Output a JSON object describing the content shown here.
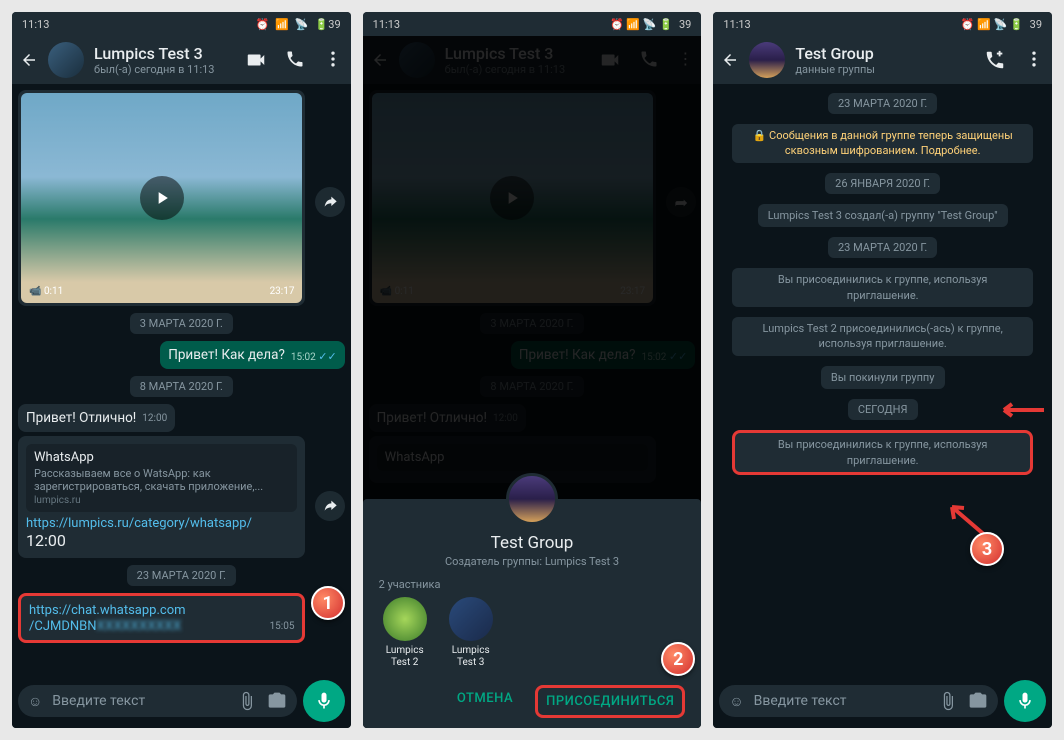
{
  "status": {
    "time": "11:13",
    "battery": "39"
  },
  "panel1": {
    "header": {
      "title": "Lumpics Test 3",
      "subtitle": "был(-а) сегодня в 11:13"
    },
    "video": {
      "duration": "0:11",
      "time": "23:17"
    },
    "dates": {
      "d1": "3 МАРТА 2020 Г.",
      "d2": "8 МАРТА 2020 Г.",
      "d3": "23 МАРТА 2020 Г."
    },
    "msg_out": {
      "text": "Привет! Как дела?",
      "time": "15:02"
    },
    "msg_in1": {
      "text": "Привет! Отлично!",
      "time": "12:00"
    },
    "preview": {
      "title": "WhatsApp",
      "desc": "Рассказываем все о WatsApp: как зарегистрироваться, скачать приложение,...",
      "domain": "lumpics.ru",
      "link": "https://lumpics.ru/category/whatsapp/",
      "time": "12:00"
    },
    "invite": {
      "line1": "https://chat.whatsapp.com",
      "line2": "/CJMDNBN",
      "time": "15:05"
    },
    "input_placeholder": "Введите текст"
  },
  "panel2": {
    "header": {
      "title": "Lumpics Test 3",
      "subtitle": "был(-а) сегодня в 11:13"
    },
    "video": {
      "duration": "0:11",
      "time": "23:17"
    },
    "dates": {
      "d1": "3 МАРТА 2020 Г.",
      "d2": "8 МАРТА 2020 Г."
    },
    "msg_out": {
      "text": "Привет! Как дела?",
      "time": "15:02"
    },
    "msg_in1": {
      "text": "Привет! Отлично!",
      "time": "12:00"
    },
    "preview_title": "WhatsApp",
    "sheet": {
      "title": "Test Group",
      "creator": "Создатель группы: Lumpics Test 3",
      "count": "2 участника",
      "m1": "Lumpics Test 2",
      "m2": "Lumpics Test 3",
      "cancel": "ОТМЕНА",
      "join": "ПРИСОЕДИНИТЬСЯ"
    }
  },
  "panel3": {
    "header": {
      "title": "Test Group",
      "subtitle": "данные группы"
    },
    "chips": {
      "d1": "23 МАРТА 2020 Г.",
      "enc": "🔒 Сообщения в данной группе теперь защищены сквозным шифрованием. Подробнее.",
      "d2": "26 ЯНВАРЯ 2020 Г.",
      "created": "Lumpics Test 3 создал(-а) группу \"Test Group\"",
      "d3": "23 МАРТА 2020 Г.",
      "joined1": "Вы присоединились к группе, используя приглашение.",
      "joined2": "Lumpics Test 2 присоединились(-ась) к группе, используя приглашение.",
      "left": "Вы покинули группу",
      "today": "СЕГОДНЯ",
      "joined3": "Вы присоединились к группе, используя приглашение."
    },
    "input_placeholder": "Введите текст"
  },
  "callouts": {
    "c1": "1",
    "c2": "2",
    "c3": "3"
  }
}
